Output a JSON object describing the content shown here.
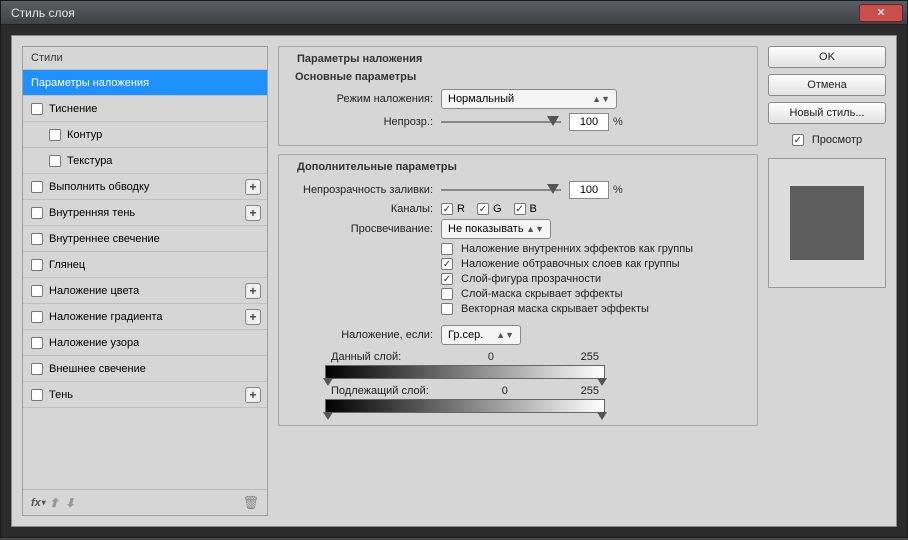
{
  "title": "Стиль слоя",
  "styles": {
    "header": "Стили",
    "items": [
      {
        "label": "Параметры наложения",
        "selected": true,
        "hasAdd": false,
        "checkbox": false,
        "indent": false
      },
      {
        "label": "Тиснение",
        "selected": false,
        "hasAdd": false,
        "checkbox": true,
        "indent": false
      },
      {
        "label": "Контур",
        "selected": false,
        "hasAdd": false,
        "checkbox": true,
        "indent": true
      },
      {
        "label": "Текстура",
        "selected": false,
        "hasAdd": false,
        "checkbox": true,
        "indent": true
      },
      {
        "label": "Выполнить обводку",
        "selected": false,
        "hasAdd": true,
        "checkbox": true,
        "indent": false
      },
      {
        "label": "Внутренняя тень",
        "selected": false,
        "hasAdd": true,
        "checkbox": true,
        "indent": false
      },
      {
        "label": "Внутреннее свечение",
        "selected": false,
        "hasAdd": false,
        "checkbox": true,
        "indent": false
      },
      {
        "label": "Глянец",
        "selected": false,
        "hasAdd": false,
        "checkbox": true,
        "indent": false
      },
      {
        "label": "Наложение цвета",
        "selected": false,
        "hasAdd": true,
        "checkbox": true,
        "indent": false
      },
      {
        "label": "Наложение градиента",
        "selected": false,
        "hasAdd": true,
        "checkbox": true,
        "indent": false
      },
      {
        "label": "Наложение узора",
        "selected": false,
        "hasAdd": false,
        "checkbox": true,
        "indent": false
      },
      {
        "label": "Внешнее свечение",
        "selected": false,
        "hasAdd": false,
        "checkbox": true,
        "indent": false
      },
      {
        "label": "Тень",
        "selected": false,
        "hasAdd": true,
        "checkbox": true,
        "indent": false
      }
    ]
  },
  "main": {
    "group_title": "Параметры наложения",
    "basic": {
      "title": "Основные параметры",
      "mode_label": "Режим наложения:",
      "mode_value": "Нормальный",
      "opacity_label": "Непрозр.:",
      "opacity_value": "100"
    },
    "advanced": {
      "title": "Дополнительные параметры",
      "fill_label": "Непрозрачность заливки:",
      "fill_value": "100",
      "channels_label": "Каналы:",
      "channels": {
        "r": "R",
        "g": "G",
        "b": "B"
      },
      "knockout_label": "Просвечивание:",
      "knockout_value": "Не показывать",
      "opts": [
        {
          "label": "Наложение внутренних эффектов как группы",
          "checked": false
        },
        {
          "label": "Наложение обтравочных слоев как группы",
          "checked": true
        },
        {
          "label": "Слой-фигура прозрачности",
          "checked": true
        },
        {
          "label": "Слой-маска скрывает эффекты",
          "checked": false
        },
        {
          "label": "Векторная маска скрывает эффекты",
          "checked": false
        }
      ]
    },
    "blendif": {
      "label": "Наложение, если:",
      "value": "Гр.сер.",
      "this_label": "Данный слой:",
      "this_min": "0",
      "this_max": "255",
      "under_label": "Подлежащий слой:",
      "under_min": "0",
      "under_max": "255"
    }
  },
  "buttons": {
    "ok": "OK",
    "cancel": "Отмена",
    "new_style": "Новый стиль...",
    "preview": "Просмотр"
  },
  "pct_sign": "%",
  "fx_label": "fx"
}
